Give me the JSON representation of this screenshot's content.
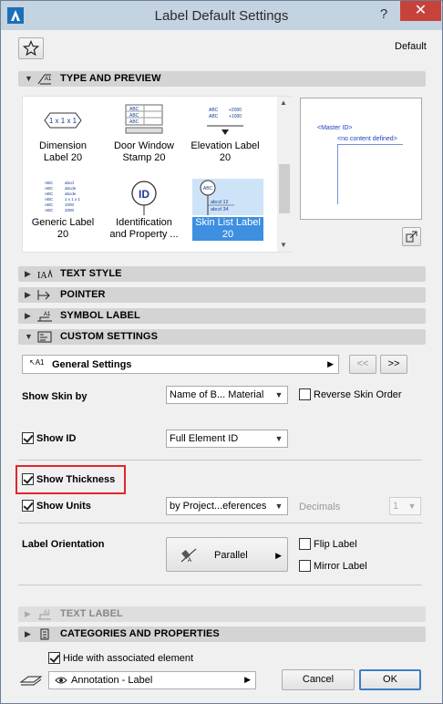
{
  "window": {
    "title": "Label Default Settings",
    "help": "?",
    "close": "✕"
  },
  "header": {
    "default_label": "Default"
  },
  "sections": {
    "type_and_preview": "TYPE AND PREVIEW",
    "text_style": "TEXT STYLE",
    "pointer": "POINTER",
    "symbol_label": "SYMBOL LABEL",
    "custom_settings": "CUSTOM SETTINGS",
    "text_label": "TEXT LABEL",
    "categories": "CATEGORIES AND PROPERTIES"
  },
  "label_types": [
    {
      "line1": "Dimension",
      "line2": "Label 20",
      "icon": "dimension-label-icon"
    },
    {
      "line1": "Door Window",
      "line2": "Stamp 20",
      "icon": "door-window-stamp-icon"
    },
    {
      "line1": "Elevation Label",
      "line2": "20",
      "icon": "elevation-label-icon"
    },
    {
      "line1": "Generic Label",
      "line2": "20",
      "icon": "generic-label-icon"
    },
    {
      "line1": "Identification",
      "line2": "and Property ...",
      "icon": "identification-label-icon"
    },
    {
      "line1": "Skin List Label",
      "line2": "20",
      "icon": "skin-list-label-icon",
      "selected": true
    }
  ],
  "icon_text": {
    "dimension": "1 x 1 x 1",
    "id": "ID",
    "abc": "ABC",
    "abcd12": "abcd 12",
    "abcd34": "abcd 34",
    "elev_a": "+2000",
    "elev_b": "+1000"
  },
  "preview": {
    "master_id": "<Master ID>",
    "no_content": "<no content defined>"
  },
  "custom": {
    "general_settings": "General Settings",
    "prev": "<<",
    "next": ">>",
    "show_skin_by_label": "Show Skin by",
    "show_skin_by_value": "Name of B... Material",
    "reverse_skin_order": "Reverse Skin Order",
    "show_id": "Show ID",
    "show_id_value": "Full Element ID",
    "show_thickness": "Show Thickness",
    "show_units": "Show Units",
    "units_value": "by Project...eferences",
    "decimals_label": "Decimals",
    "decimals_value": "1",
    "label_orientation": "Label Orientation",
    "orientation_value": "Parallel",
    "flip_label": "Flip Label",
    "mirror_label": "Mirror Label"
  },
  "footer": {
    "hide_with_element": "Hide with associated element",
    "layer_value": "Annotation - Label",
    "cancel": "Cancel",
    "ok": "OK"
  },
  "colors": {
    "highlight_border": "#e0262d",
    "selection": "#3d8fe0"
  }
}
